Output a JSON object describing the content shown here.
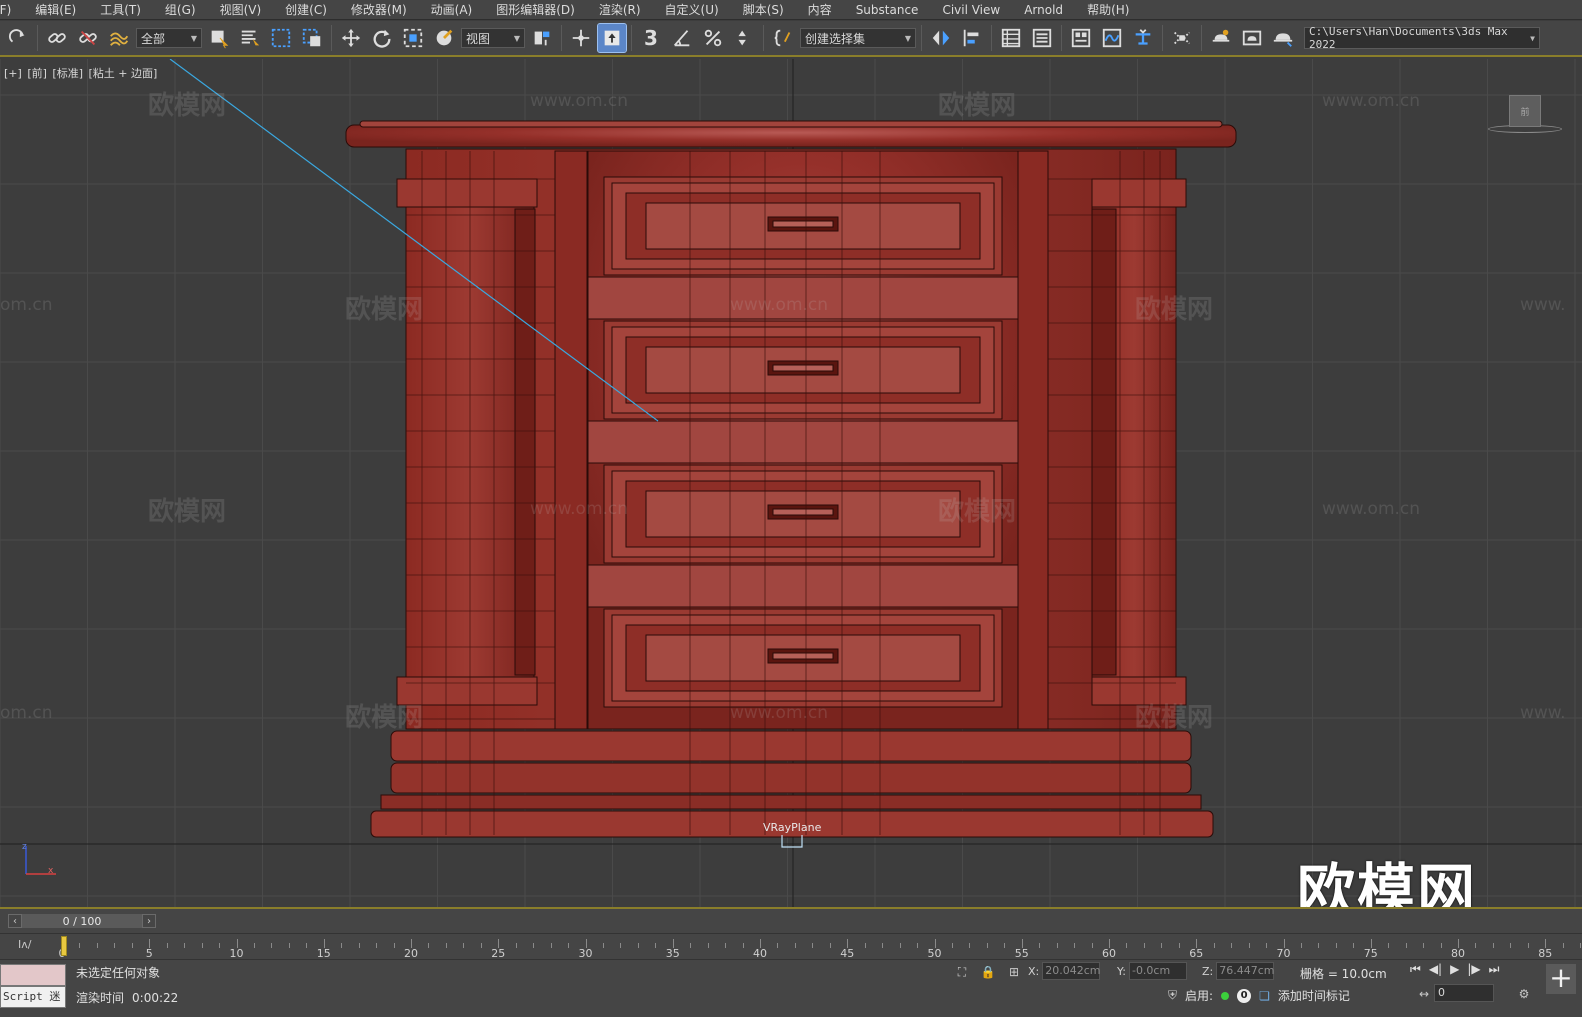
{
  "menubar": {
    "items": [
      "(F)",
      "编辑(E)",
      "工具(T)",
      "组(G)",
      "视图(V)",
      "创建(C)",
      "修改器(M)",
      "动画(A)",
      "图形编辑器(D)",
      "渲染(R)",
      "自定义(U)",
      "脚本(S)",
      "内容",
      "Substance",
      "Civil View",
      "Arnold",
      "帮助(H)"
    ]
  },
  "toolbar": {
    "selection_filter": "全部",
    "reference_coord": "视图",
    "named_selection": "创建选择集",
    "project_path": "C:\\Users\\Han\\Documents\\3ds Max 2022",
    "snap_label": "3",
    "icons": [
      "redo-icon",
      "link-icon",
      "unlink-icon",
      "bind-spacewarp-icon",
      "select-object-icon",
      "select-by-name-icon",
      "rect-region-icon",
      "window-crossing-icon",
      "move-icon",
      "rotate-icon",
      "scale-icon",
      "placement-icon",
      "pivot-icon",
      "manipulate-icon",
      "keyboard-shortcut-icon",
      "snaps-toggle-icon",
      "angle-snap-icon",
      "percent-snap-icon",
      "spinner-snap-icon",
      "edit-named-sets-icon",
      "mirror-icon",
      "align-icon",
      "scene-explorer-icon",
      "layer-explorer-icon",
      "ribbon-icon",
      "curve-editor-icon",
      "schematic-view-icon",
      "material-editor-icon",
      "render-setup-icon",
      "rendered-frame-icon",
      "render-icon"
    ]
  },
  "viewport": {
    "label_parts": [
      "[+]",
      "[前]",
      "[标准]",
      "[粘土 + 边面]"
    ],
    "object_label": "VRayPlane",
    "viewcube_label": "前",
    "watermark_text": "欧模网",
    "watermark_url": "www.om.cn",
    "watermark_url_partial": "om.cn",
    "watermark_url_clip": "www.",
    "corner_logo": "欧模网",
    "colors": {
      "background": "#3d3d3d",
      "grid": "#4a4a4a",
      "model": "#8b2820",
      "model_edge": "#2a0b08",
      "selection_line": "#3aa8e0"
    }
  },
  "timeline": {
    "frame_display": "0 / 100",
    "ruler_labels": [
      "0",
      "5",
      "10",
      "15",
      "20",
      "25",
      "30",
      "35",
      "40",
      "45",
      "50",
      "55",
      "60",
      "65",
      "70",
      "75",
      "80",
      "85"
    ]
  },
  "statusbar": {
    "maxscript_text": "Script 迷",
    "status": "未选定任何对象",
    "render_time_label": "渲染时间",
    "render_time_value": "0:00:22",
    "x_label": "X:",
    "x_value": "20.042cm",
    "y_label": "Y:",
    "y_value": "-0.0cm",
    "z_label": "Z:",
    "z_value": "76.447cm",
    "grid_text": "栅格 = 10.0cm",
    "enable_label": "启用:",
    "enable_count": "0",
    "add_time_tag": "添加时间标记",
    "frame_value": "0"
  }
}
